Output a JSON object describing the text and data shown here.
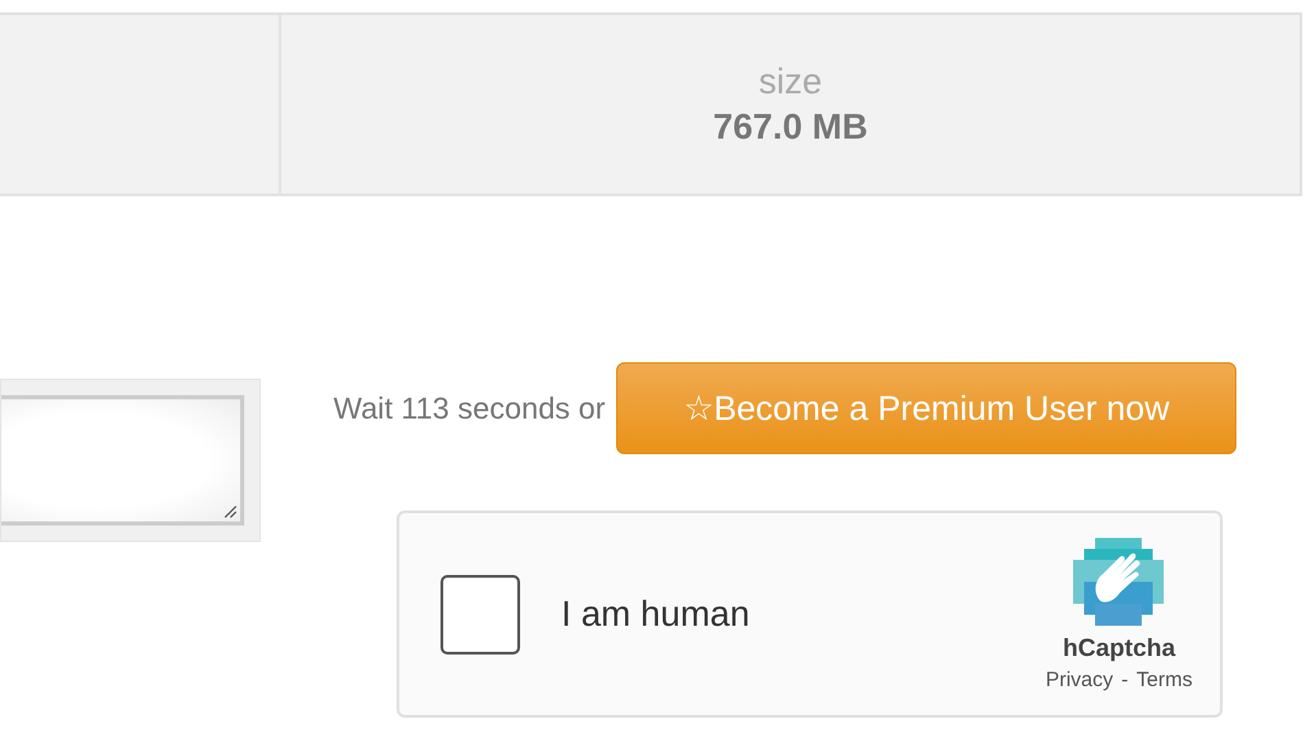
{
  "info_table": {
    "cells": [
      {
        "label": "size",
        "value": "767.0 MB"
      }
    ]
  },
  "download": {
    "wait_text": "Wait 113 seconds or",
    "premium_button": "☆Become a Premium User now"
  },
  "captcha": {
    "checked": false,
    "label": "I am human",
    "brand": "hCaptcha",
    "links": [
      "Privacy",
      "Terms"
    ],
    "separator": "-"
  }
}
